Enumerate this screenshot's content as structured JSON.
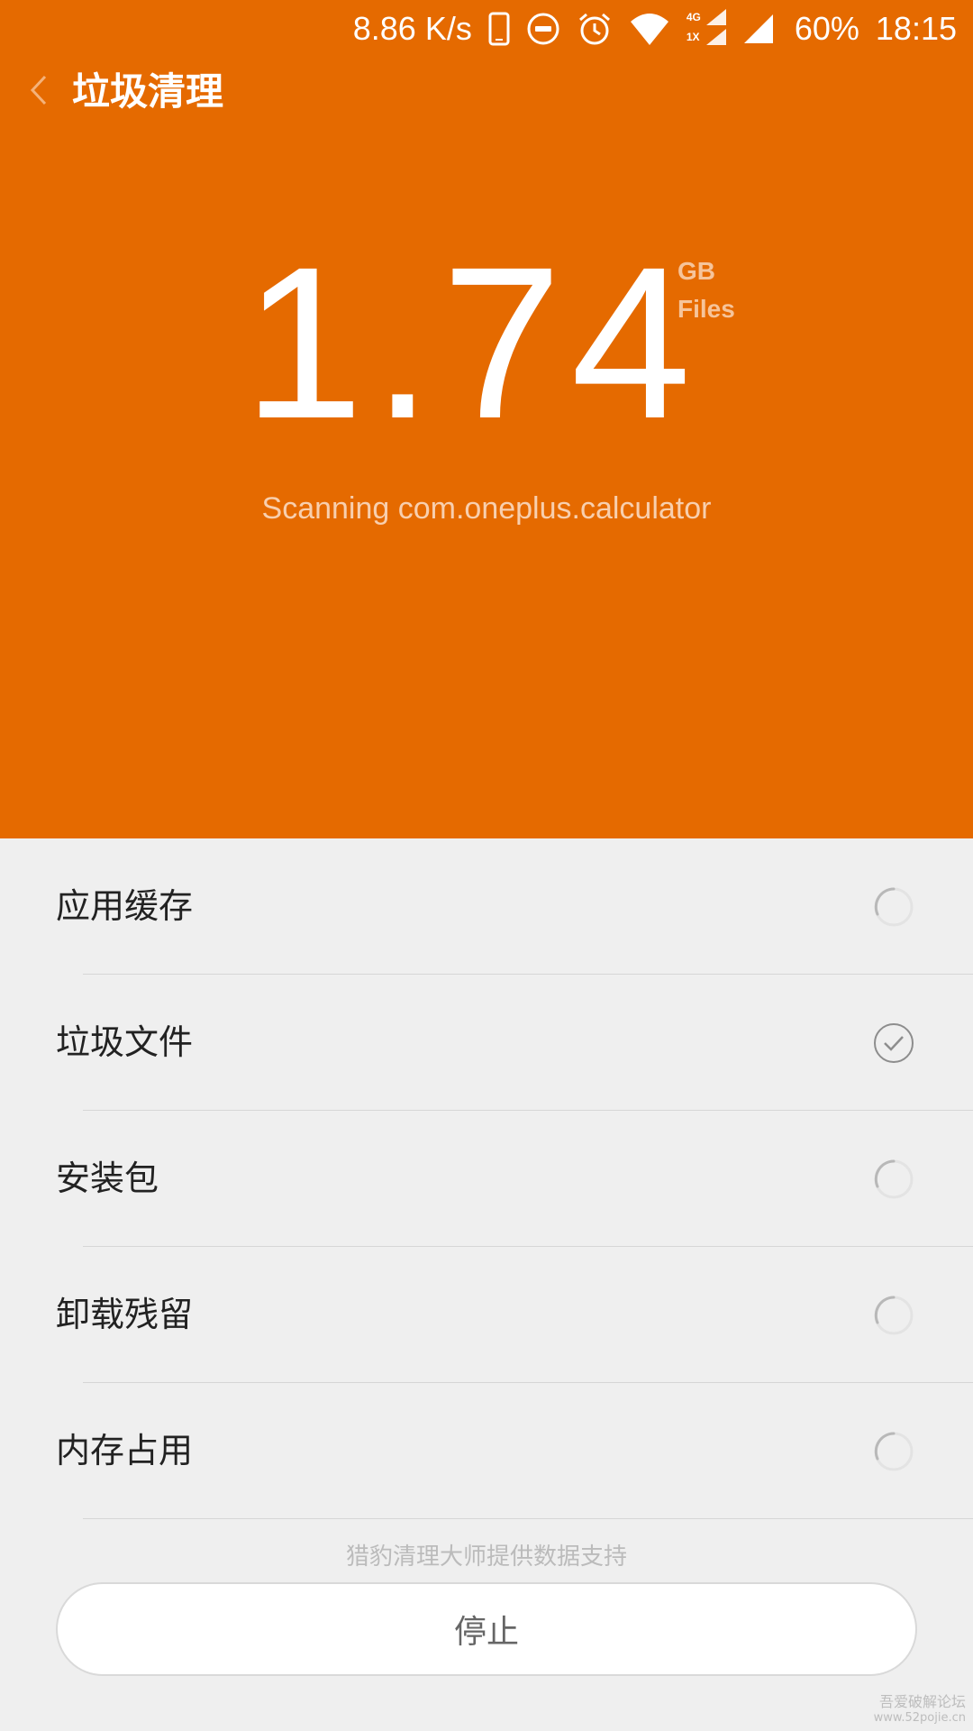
{
  "status_bar": {
    "network_speed": "8.86 K/s",
    "network_type_top": "4G",
    "network_type_bottom": "1X",
    "battery": "60%",
    "time": "18:15",
    "icons": [
      "phone-icon",
      "dnd-icon",
      "alarm-icon",
      "wifi-icon",
      "signal-icon",
      "signal-icon"
    ]
  },
  "header": {
    "title": "垃圾清理",
    "back_icon": "chevron-left-icon"
  },
  "scan": {
    "size_value": "1.74",
    "size_unit": "GB",
    "size_label": "Files",
    "status_text": "Scanning com.oneplus.calculator"
  },
  "list": {
    "items": [
      {
        "label": "应用缓存",
        "state": "loading"
      },
      {
        "label": "垃圾文件",
        "state": "done"
      },
      {
        "label": "安装包",
        "state": "loading"
      },
      {
        "label": "卸载残留",
        "state": "loading"
      },
      {
        "label": "内存占用",
        "state": "loading"
      }
    ]
  },
  "footer": {
    "note": "猎豹清理大师提供数据支持",
    "stop_label": "停止"
  },
  "watermark": {
    "line1": "吾爱破解论坛",
    "line2": "www.52pojie.cn"
  },
  "colors": {
    "accent": "#e56a00",
    "background": "#efefef"
  }
}
